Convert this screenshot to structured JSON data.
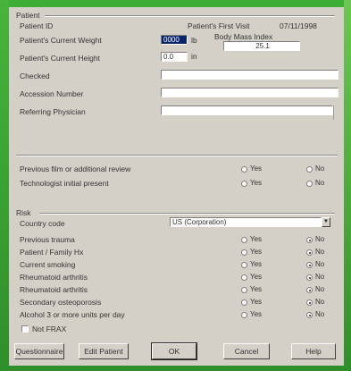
{
  "patient": {
    "section": "Patient",
    "id_label": "Patient ID",
    "first_visit_label": "Patient's First Visit",
    "first_visit_value": "07/11/1998",
    "current_weight_label": "Patient's Current Weight",
    "current_weight_value": "0000",
    "weight_unit": "lb",
    "body_mass_label": "Body Mass Index",
    "body_mass_value": "25.1",
    "current_height_label": "Patient's Current Height",
    "current_height_value": "0.0",
    "height_unit": "in",
    "checked_label": "Checked",
    "accession_label": "Accession Number",
    "referring_label": "Referring Physician"
  },
  "questions": {
    "q1": "Previous film or additional review",
    "q2": "Technologist initial present",
    "yes": "Yes",
    "no": "No"
  },
  "risk": {
    "section": "Risk",
    "country_label": "Country code",
    "country_value": "US (Corporation)",
    "rows": [
      "Previous trauma",
      "Patient / Family Hx",
      "Current smoking",
      "Rheumatoid arthritis",
      "Rheumatoid arthritis",
      "Secondary osteoporosis",
      "Alcohol 3 or more units per day"
    ],
    "not_risk_label": "Not FRAX",
    "yes": "Yes",
    "no": "No"
  },
  "buttons": {
    "b1": "Questionnaire",
    "b2": "Edit Patient",
    "ok": "OK",
    "cancel": "Cancel",
    "help": "Help"
  }
}
